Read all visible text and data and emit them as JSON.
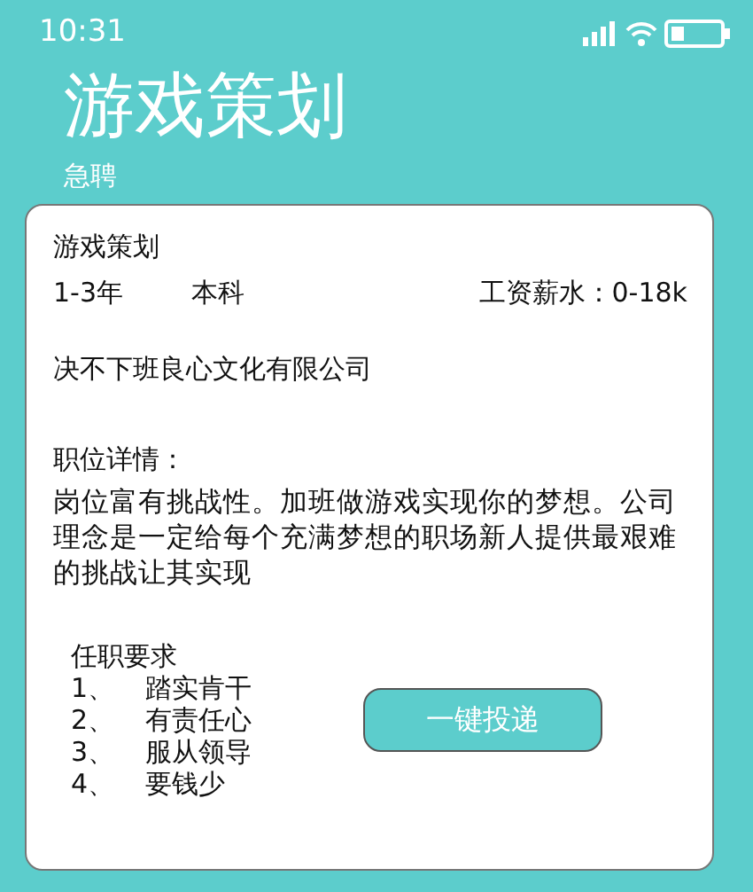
{
  "status_bar": {
    "time": "10:31"
  },
  "header": {
    "title": "游戏策划",
    "subtitle": "急聘"
  },
  "job": {
    "title": "游戏策划",
    "experience": "1-3年",
    "education": "本科",
    "salary": "工资薪水：0-18k",
    "company": "决不下班良心文化有限公司",
    "details_label": "职位详情：",
    "details": "岗位富有挑战性。加班做游戏实现你的梦想。公司理念是一定给每个充满梦想的职场新人提供最艰难的挑战让其实现",
    "requirements_label": "任职要求",
    "requirements": [
      {
        "number": "1、",
        "text": "踏实肯干"
      },
      {
        "number": "2、",
        "text": "有责任心"
      },
      {
        "number": "3、",
        "text": "服从领导"
      },
      {
        "number": "4、",
        "text": "要钱少"
      }
    ],
    "apply_button": "一键投递"
  }
}
